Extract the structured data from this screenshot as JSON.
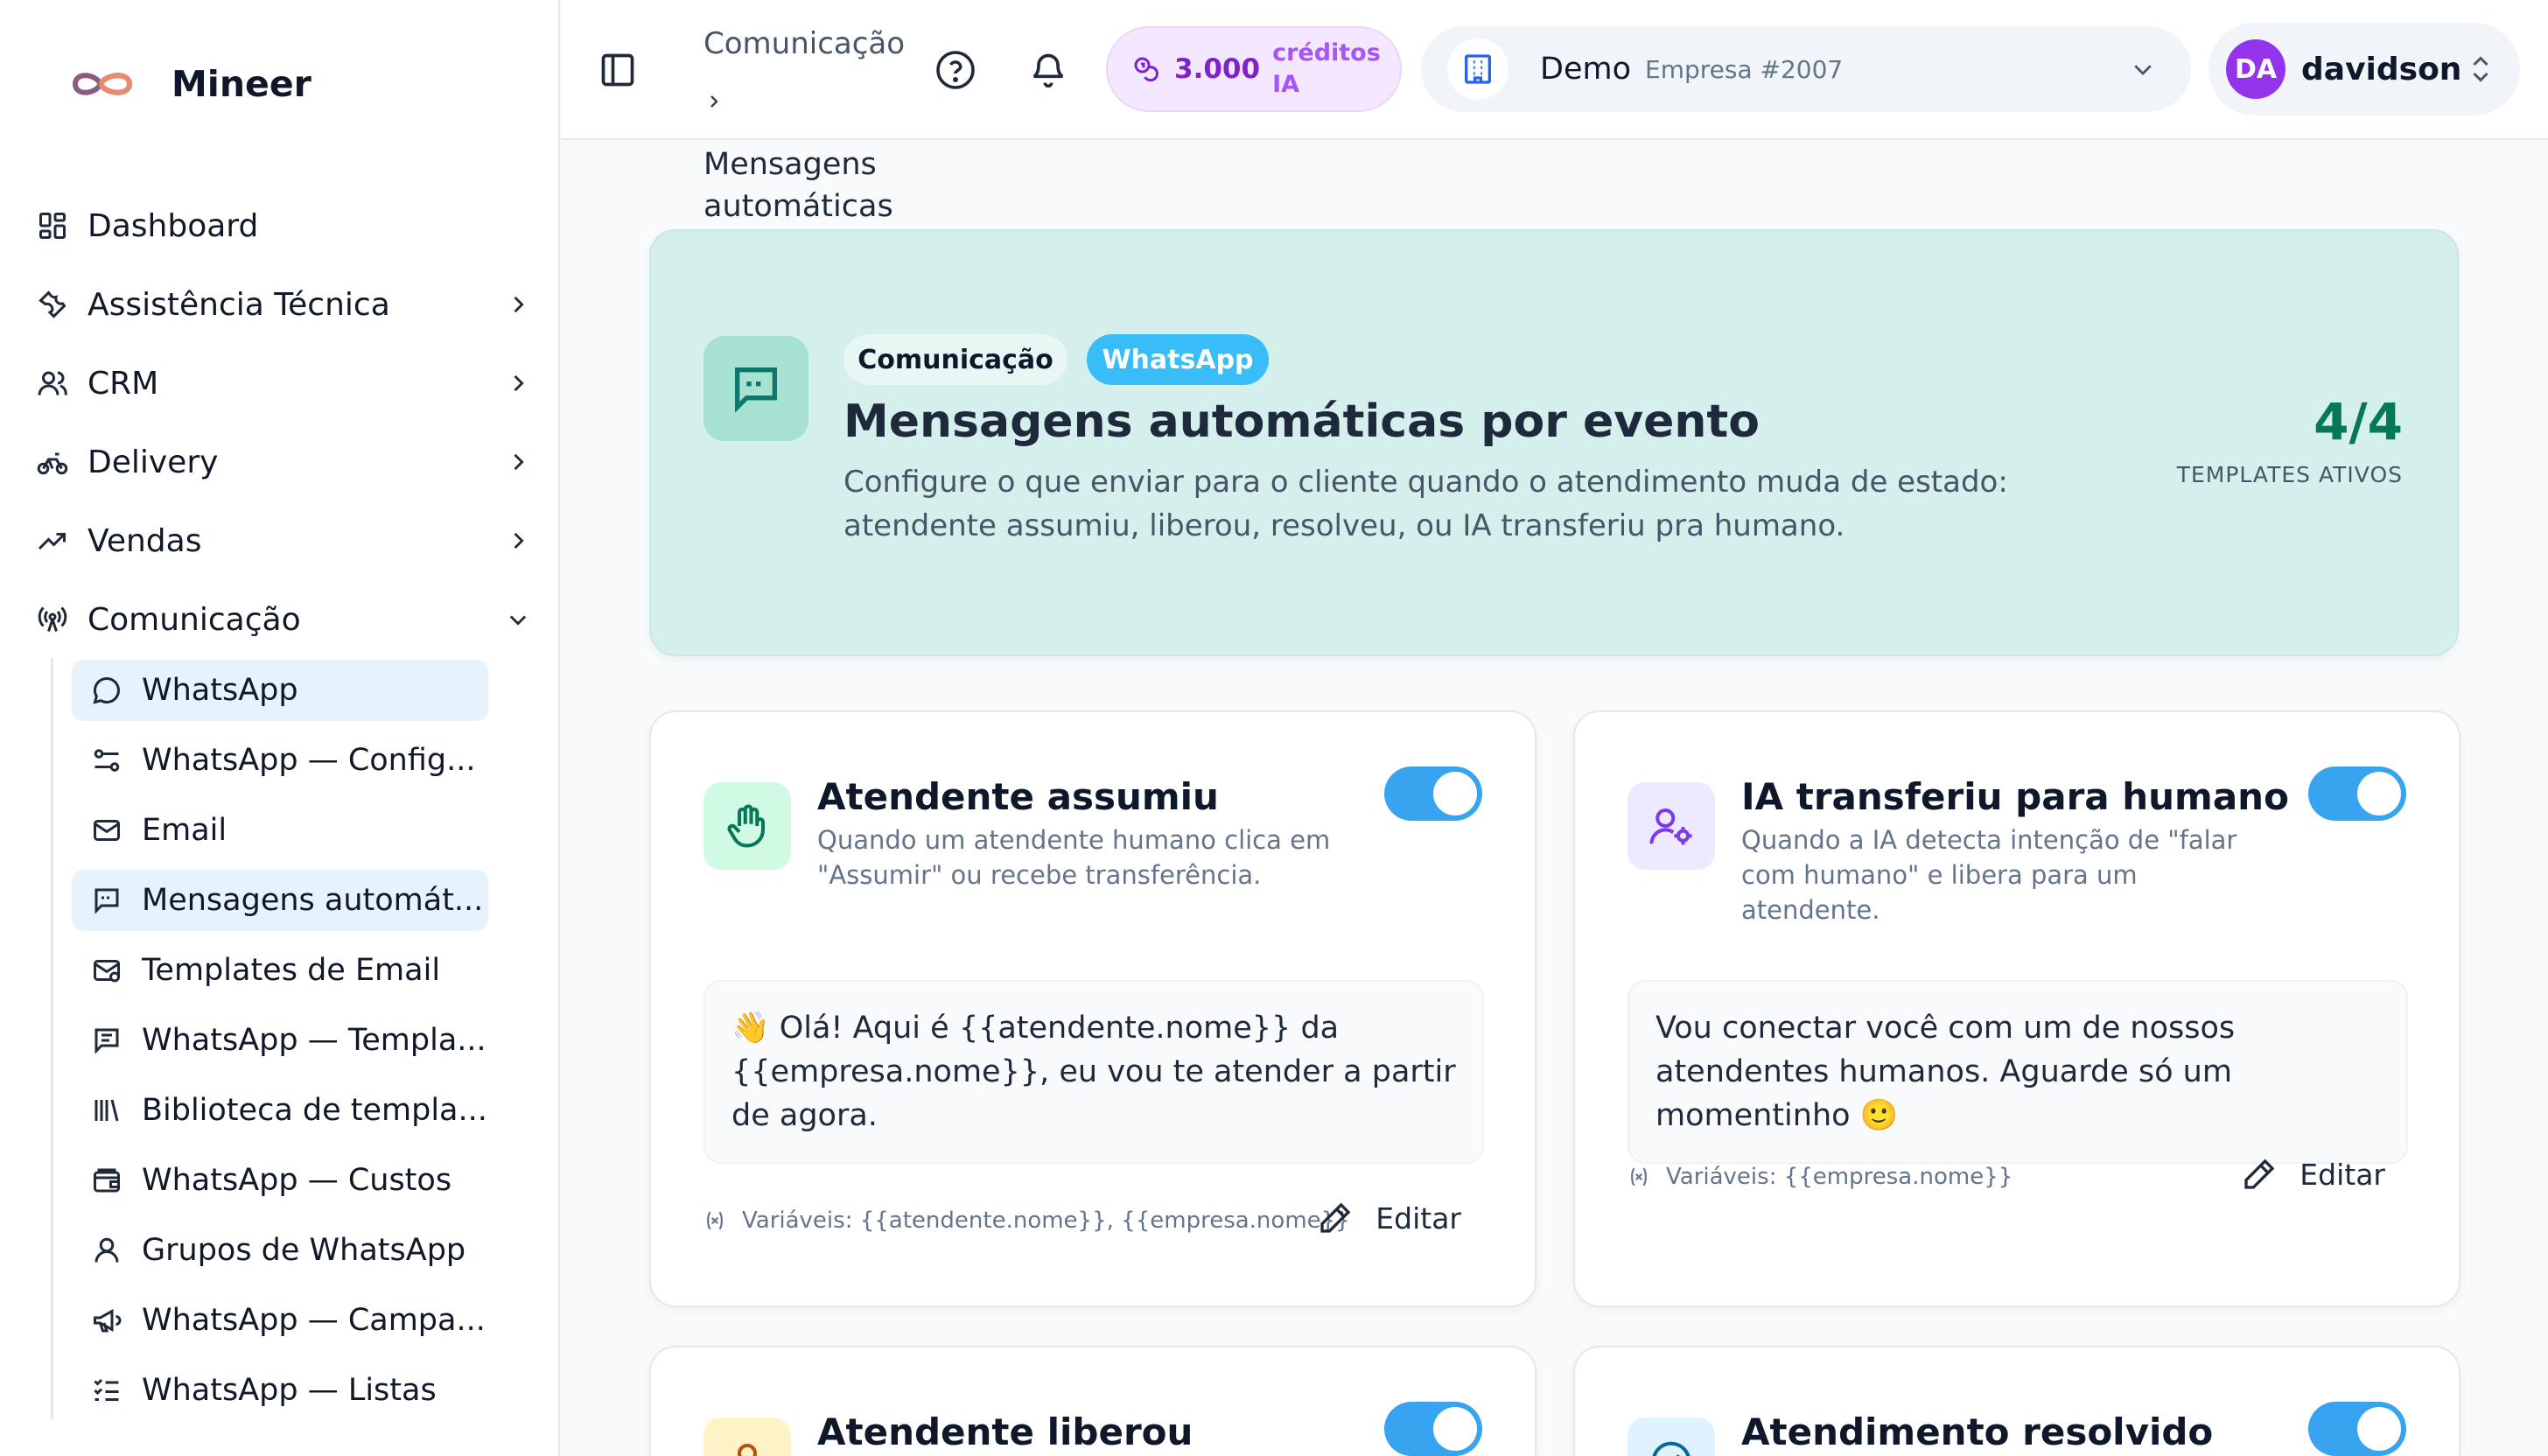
{
  "brand": {
    "name": "Mineer"
  },
  "sidebar": {
    "items": [
      {
        "label": "Dashboard",
        "icon": "dashboard-icon"
      },
      {
        "label": "Assistência Técnica",
        "icon": "wrench-icon"
      },
      {
        "label": "CRM",
        "icon": "users-icon"
      },
      {
        "label": "Delivery",
        "icon": "bike-icon"
      },
      {
        "label": "Vendas",
        "icon": "trending-up-icon"
      },
      {
        "label": "Comunicação",
        "icon": "broadcast-icon"
      }
    ],
    "sub_items": [
      {
        "label": "WhatsApp",
        "icon": "chat-bubble-icon",
        "active": true
      },
      {
        "label": "WhatsApp — Config...",
        "icon": "settings-sliders-icon"
      },
      {
        "label": "Email",
        "icon": "mail-icon"
      },
      {
        "label": "Mensagens automát...",
        "icon": "message-quote-icon",
        "active": true
      },
      {
        "label": "Templates de Email",
        "icon": "mail-template-icon"
      },
      {
        "label": "WhatsApp — Templa...",
        "icon": "message-lines-icon"
      },
      {
        "label": "Biblioteca de templa...",
        "icon": "library-icon"
      },
      {
        "label": "WhatsApp — Custos",
        "icon": "wallet-icon"
      },
      {
        "label": "Grupos de WhatsApp",
        "icon": "user-icon"
      },
      {
        "label": "WhatsApp — Campa...",
        "icon": "megaphone-icon"
      },
      {
        "label": "WhatsApp — Listas",
        "icon": "checklist-icon"
      }
    ]
  },
  "header": {
    "breadcrumb_parent": "Comunicação",
    "breadcrumb_current": "Mensagens automáticas",
    "credits_value": "3.000",
    "credits_label": "créditos IA",
    "company_name": "Demo",
    "company_sub": "Empresa #2007",
    "user_initials": "DA",
    "user_name": "davidson"
  },
  "hero": {
    "chip_1": "Comunicação",
    "chip_2": "WhatsApp",
    "title": "Mensagens automáticas por evento",
    "description": "Configure o que enviar para o cliente quando o atendimento muda de estado: atendente assumiu, liberou, resolveu, ou IA transferiu pra humano.",
    "count": "4/4",
    "count_label": "TEMPLATES ATIVOS"
  },
  "cards": [
    {
      "title": "Atendente assumiu",
      "description": "Quando um atendente humano clica em \"Assumir\" ou recebe transferência.",
      "message": "👋 Olá! Aqui é {{atendente.nome}} da {{empresa.nome}}, eu vou te atender a partir de agora.",
      "variables": "Variáveis: {{atendente.nome}}, {{empresa.nome}}",
      "edit_label": "Editar",
      "enabled": true
    },
    {
      "title": "IA transferiu para humano",
      "description": "Quando a IA detecta intenção de \"falar com humano\" e libera para um atendente.",
      "message": "Vou conectar você com um de nossos atendentes humanos. Aguarde só um momentinho 🙂",
      "variables": "Variáveis: {{empresa.nome}}",
      "edit_label": "Editar",
      "enabled": true
    },
    {
      "title": "Atendente liberou",
      "enabled": true
    },
    {
      "title": "Atendimento resolvido",
      "enabled": true
    }
  ],
  "colors": {
    "accent": "#38a4f0",
    "hero_bg": "#d5efec",
    "count": "#047857",
    "credits": "#7e22ce",
    "avatar": "#9333ea"
  }
}
